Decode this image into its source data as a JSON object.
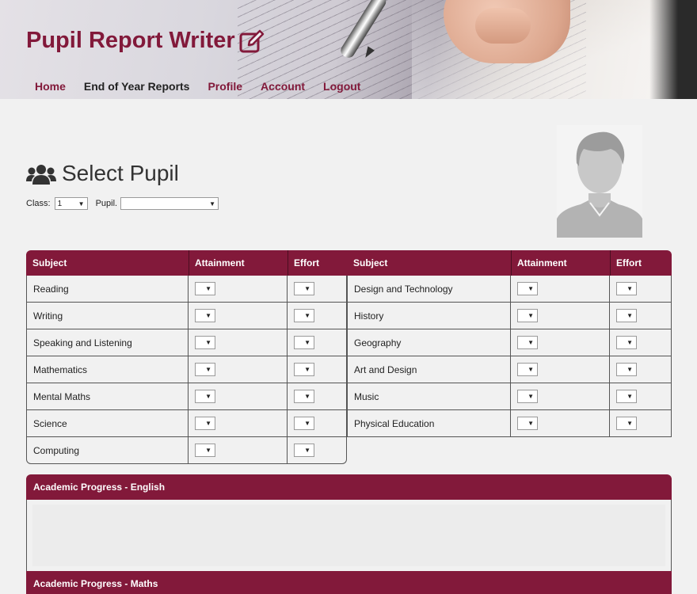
{
  "app": {
    "title": "Pupil Report Writer",
    "title_icon": "edit-icon",
    "accent_color": "#82193a"
  },
  "nav": {
    "items": [
      {
        "label": "Home",
        "active": false
      },
      {
        "label": "End of Year Reports",
        "active": true
      },
      {
        "label": "Profile",
        "active": false
      },
      {
        "label": "Account",
        "active": false
      },
      {
        "label": "Logout",
        "active": false
      }
    ]
  },
  "select_pupil": {
    "heading": "Select Pupil",
    "icon": "users-icon",
    "class_label": "Class:",
    "class_value": "1",
    "pupil_label": "Pupil.",
    "pupil_value": ""
  },
  "subjects_table": {
    "headers": [
      "Subject",
      "Attainment",
      "Effort"
    ],
    "left": [
      {
        "subject": "Reading"
      },
      {
        "subject": "Writing"
      },
      {
        "subject": "Speaking and Listening"
      },
      {
        "subject": "Mathematics"
      },
      {
        "subject": "Mental Maths"
      },
      {
        "subject": "Science"
      },
      {
        "subject": "Computing"
      }
    ],
    "right": [
      {
        "subject": "Design and Technology"
      },
      {
        "subject": "History"
      },
      {
        "subject": "Geography"
      },
      {
        "subject": "Art and Design"
      },
      {
        "subject": "Music"
      },
      {
        "subject": "Physical Education"
      }
    ]
  },
  "progress_panels": [
    {
      "title": "Academic Progress - English",
      "text": ""
    },
    {
      "title": "Academic Progress - Maths",
      "text": ""
    }
  ]
}
